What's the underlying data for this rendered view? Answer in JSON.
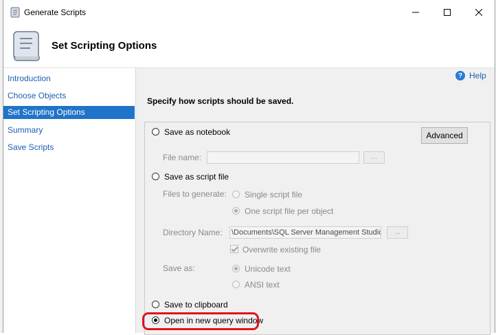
{
  "window": {
    "title": "Generate Scripts",
    "controls": {
      "minimize_icon": "minimize-icon",
      "maximize_icon": "maximize-icon",
      "close_icon": "close-icon"
    }
  },
  "header": {
    "title": "Set Scripting Options",
    "icon": "scroll-icon"
  },
  "nav": {
    "items": [
      {
        "label": "Introduction",
        "selected": false
      },
      {
        "label": "Choose Objects",
        "selected": false
      },
      {
        "label": "Set Scripting Options",
        "selected": true
      },
      {
        "label": "Summary",
        "selected": false
      },
      {
        "label": "Save Scripts",
        "selected": false
      }
    ]
  },
  "help": {
    "label": "Help",
    "icon": "help-icon"
  },
  "instruction": "Specify how scripts should be saved.",
  "options": {
    "notebook": {
      "label": "Save as notebook",
      "selected": false
    },
    "advanced_button": "Advanced",
    "file_name": {
      "label": "File name:",
      "value": "",
      "browse": "..."
    },
    "script_file": {
      "label": "Save as script file",
      "selected": false
    },
    "files_to_generate": {
      "label": "Files to generate:",
      "single": {
        "label": "Single script file",
        "selected": false
      },
      "per_object": {
        "label": "One script file per object",
        "selected": true
      }
    },
    "directory": {
      "label": "Directory Name:",
      "value": "\\Documents\\SQL Server Management Studio",
      "browse": "..."
    },
    "overwrite": {
      "label": "Overwrite existing file",
      "checked": true
    },
    "save_as": {
      "label": "Save as:",
      "unicode": {
        "label": "Unicode text",
        "selected": true
      },
      "ansi": {
        "label": "ANSI text",
        "selected": false
      }
    },
    "clipboard": {
      "label": "Save to clipboard",
      "selected": false
    },
    "query_window": {
      "label": "Open in new query window",
      "selected": true
    }
  },
  "colors": {
    "highlight": "#e0131a",
    "selection": "#1f73c9",
    "link": "#1a5fb4"
  }
}
